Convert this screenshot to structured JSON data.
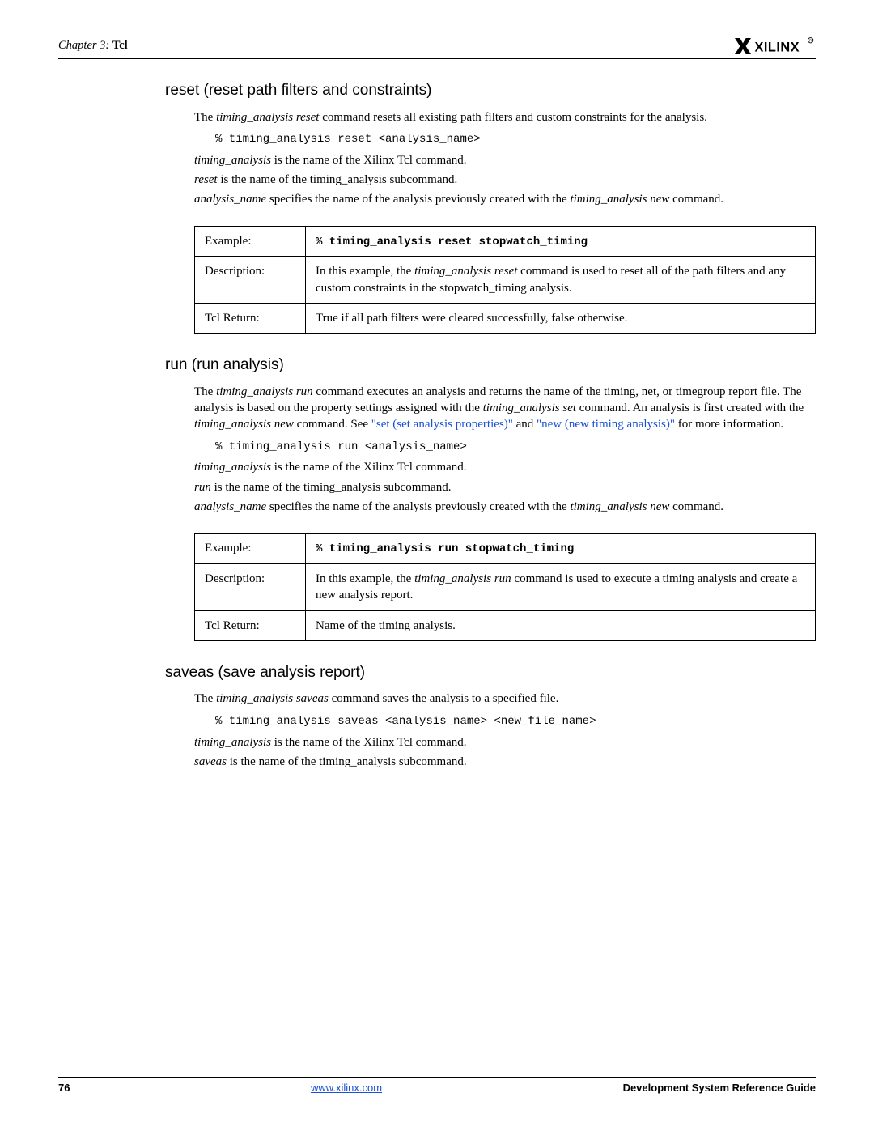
{
  "header": {
    "chapter_prefix": "Chapter 3:",
    "chapter_name": "Tcl"
  },
  "section_reset": {
    "heading": "reset (reset path filters and constraints)",
    "intro_pre": "The ",
    "intro_cmd_i": "timing_analysis reset",
    "intro_post": " command resets all existing path filters and custom constraints for the analysis.",
    "code": "% timing_analysis reset <analysis_name>",
    "p1_i": "timing_analysis",
    "p1_post": " is the name of the Xilinx Tcl command.",
    "p2_i": "reset",
    "p2_post": " is the name of the timing_analysis subcommand.",
    "p3_i1": "analysis_name",
    "p3_mid": " specifies the name of the analysis previously created with the ",
    "p3_i2": "timing_analysis new",
    "p3_post": " command.",
    "table": {
      "r0l": "Example:",
      "r0r": "% timing_analysis reset stopwatch_timing",
      "r1l": "Description:",
      "r1r_pre": "In this example, the ",
      "r1r_i": "timing_analysis reset",
      "r1r_post": " command is used to reset all of the path filters and any custom constraints in the stopwatch_timing analysis.",
      "r2l": "Tcl Return:",
      "r2r": "True if all path filters were cleared successfully, false otherwise."
    }
  },
  "section_run": {
    "heading": "run (run analysis)",
    "intro_pre": "The ",
    "intro_cmd_i": "timing_analysis run",
    "intro_mid1": " command executes an analysis and returns the name of the timing, net, or timegroup report file. The analysis is based on the property settings assigned with the ",
    "intro_i2": "timing_analysis set",
    "intro_mid2": " command. An analysis is first created with the ",
    "intro_i3": "timing_analysis new",
    "intro_mid3": " command. See ",
    "link1": "\"set (set analysis properties)\"",
    "intro_and": " and ",
    "link2": "\"new (new timing analysis)\"",
    "intro_post": " for more information.",
    "code": "% timing_analysis run <analysis_name>",
    "p1_i": "timing_analysis",
    "p1_post": " is the name of the Xilinx Tcl command.",
    "p2_i": "run",
    "p2_post": " is the name of the timing_analysis subcommand.",
    "p3_i1": "analysis_name",
    "p3_mid": " specifies the name of the analysis previously created with the ",
    "p3_i2": "timing_analysis new",
    "p3_post": " command.",
    "table": {
      "r0l": "Example:",
      "r0r": "% timing_analysis run stopwatch_timing",
      "r1l": "Description:",
      "r1r_pre": "In this example, the ",
      "r1r_i": "timing_analysis run",
      "r1r_post": " command is used to execute a timing analysis and create a new analysis report.",
      "r2l": "Tcl Return:",
      "r2r": "Name of the timing analysis."
    }
  },
  "section_saveas": {
    "heading": "saveas (save analysis report)",
    "intro_pre": "The ",
    "intro_cmd_i": "timing_analysis saveas",
    "intro_post": " command saves the analysis to a specified file.",
    "code": "% timing_analysis saveas <analysis_name> <new_file_name>",
    "p1_i": "timing_analysis",
    "p1_post": " is the name of the Xilinx Tcl command.",
    "p2_i": "saveas",
    "p2_post": " is the name of the timing_analysis subcommand."
  },
  "footer": {
    "page": "76",
    "url": "www.xilinx.com",
    "doc": "Development System Reference Guide"
  }
}
